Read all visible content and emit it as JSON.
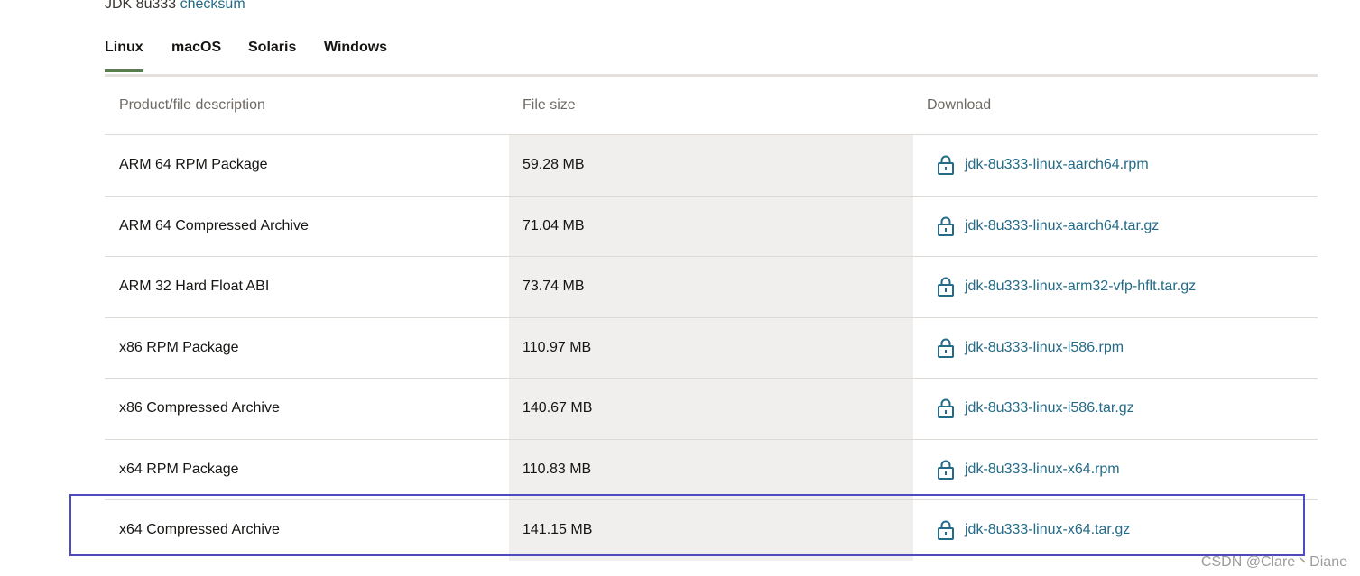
{
  "header": {
    "title_prefix": "JDK 8u333",
    "checksum_link": "checksum"
  },
  "tabs": [
    {
      "label": "Linux",
      "active": true
    },
    {
      "label": "macOS",
      "active": false
    },
    {
      "label": "Solaris",
      "active": false
    },
    {
      "label": "Windows",
      "active": false
    }
  ],
  "table": {
    "headers": [
      "Product/file description",
      "File size",
      "Download"
    ],
    "rows": [
      {
        "description": "ARM 64 RPM Package",
        "size": "59.28 MB",
        "file": "jdk-8u333-linux-aarch64.rpm"
      },
      {
        "description": "ARM 64 Compressed Archive",
        "size": "71.04 MB",
        "file": "jdk-8u333-linux-aarch64.tar.gz"
      },
      {
        "description": "ARM 32 Hard Float ABI",
        "size": "73.74 MB",
        "file": "jdk-8u333-linux-arm32-vfp-hflt.tar.gz"
      },
      {
        "description": "x86 RPM Package",
        "size": "110.97 MB",
        "file": "jdk-8u333-linux-i586.rpm"
      },
      {
        "description": "x86 Compressed Archive",
        "size": "140.67 MB",
        "file": "jdk-8u333-linux-i586.tar.gz"
      },
      {
        "description": "x64 RPM Package",
        "size": "110.83 MB",
        "file": "jdk-8u333-linux-x64.rpm"
      },
      {
        "description": "x64 Compressed Archive",
        "size": "141.15 MB",
        "file": "jdk-8u333-linux-x64.tar.gz"
      }
    ]
  },
  "icons": {
    "download": "lock-icon"
  },
  "colors": {
    "link": "#246b88",
    "active_tab_underline": "#5a7d4e",
    "size_column_bg": "#f1efed",
    "highlight_border": "#4e4bc2"
  },
  "watermark": "CSDN @Clare丶Diane"
}
